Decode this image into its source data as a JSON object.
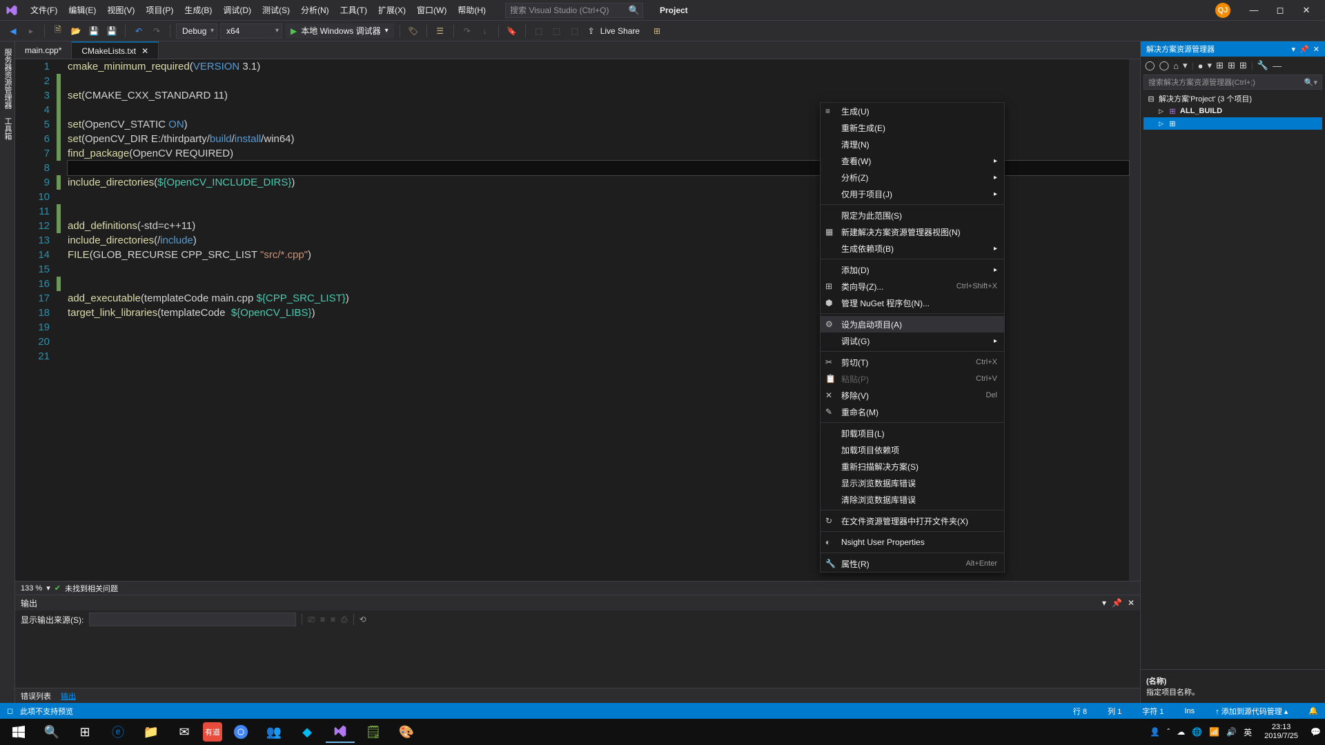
{
  "titlebar": {
    "menus": [
      "文件(F)",
      "编辑(E)",
      "视图(V)",
      "项目(P)",
      "生成(B)",
      "调试(D)",
      "测试(S)",
      "分析(N)",
      "工具(T)",
      "扩展(X)",
      "窗口(W)",
      "帮助(H)"
    ],
    "search_placeholder": "搜索 Visual Studio (Ctrl+Q)",
    "project": "Project",
    "avatar": "QJ"
  },
  "toolbar": {
    "config": "Debug",
    "platform": "x64",
    "run": "本地 Windows 调试器",
    "live_share": "Live Share"
  },
  "tabs": [
    {
      "label": "main.cpp*",
      "active": false
    },
    {
      "label": "CMakeLists.txt",
      "active": true
    }
  ],
  "editor": {
    "lines": [
      {
        "n": 1,
        "mod": false,
        "tokens": [
          [
            "fn",
            "cmake_minimum_required"
          ],
          [
            "txt",
            "("
          ],
          [
            "kw",
            "VERSION"
          ],
          [
            "txt",
            " 3.1)"
          ]
        ]
      },
      {
        "n": 2,
        "mod": true,
        "tokens": []
      },
      {
        "n": 3,
        "mod": true,
        "tokens": [
          [
            "fn",
            "set"
          ],
          [
            "txt",
            "(CMAKE_CXX_STANDARD 11)"
          ]
        ]
      },
      {
        "n": 4,
        "mod": true,
        "tokens": []
      },
      {
        "n": 5,
        "mod": true,
        "tokens": [
          [
            "fn",
            "set"
          ],
          [
            "txt",
            "(OpenCV_STATIC "
          ],
          [
            "kw",
            "ON"
          ],
          [
            "txt",
            ")"
          ]
        ]
      },
      {
        "n": 6,
        "mod": true,
        "tokens": [
          [
            "fn",
            "set"
          ],
          [
            "txt",
            "(OpenCV_DIR E:/thirdparty/"
          ],
          [
            "path",
            "build"
          ],
          [
            "txt",
            "/"
          ],
          [
            "path",
            "install"
          ],
          [
            "txt",
            "/win64)"
          ]
        ]
      },
      {
        "n": 7,
        "mod": true,
        "tokens": [
          [
            "fn",
            "find_package"
          ],
          [
            "txt",
            "(OpenCV REQUIRED)"
          ]
        ]
      },
      {
        "n": 8,
        "mod": false,
        "current": true,
        "tokens": []
      },
      {
        "n": 9,
        "mod": true,
        "tokens": [
          [
            "fn",
            "include_directories"
          ],
          [
            "txt",
            "("
          ],
          [
            "var",
            "${OpenCV_INCLUDE_DIRS}"
          ],
          [
            "txt",
            ")"
          ]
        ]
      },
      {
        "n": 10,
        "mod": false,
        "tokens": []
      },
      {
        "n": 11,
        "mod": true,
        "tokens": []
      },
      {
        "n": 12,
        "mod": true,
        "tokens": [
          [
            "fn",
            "add_definitions"
          ],
          [
            "txt",
            "(-std=c++11)"
          ]
        ]
      },
      {
        "n": 13,
        "mod": false,
        "tokens": [
          [
            "fn",
            "include_directories"
          ],
          [
            "txt",
            "(/"
          ],
          [
            "path",
            "include"
          ],
          [
            "txt",
            ")"
          ]
        ]
      },
      {
        "n": 14,
        "mod": false,
        "tokens": [
          [
            "fn",
            "FILE"
          ],
          [
            "txt",
            "(GLOB_RECURSE CPP_SRC_LIST "
          ],
          [
            "str",
            "\"src/*.cpp\""
          ],
          [
            "txt",
            ")"
          ]
        ]
      },
      {
        "n": 15,
        "mod": false,
        "tokens": []
      },
      {
        "n": 16,
        "mod": true,
        "tokens": []
      },
      {
        "n": 17,
        "mod": false,
        "tokens": [
          [
            "fn",
            "add_executable"
          ],
          [
            "txt",
            "(templateCode main.cpp "
          ],
          [
            "var",
            "${CPP_SRC_LIST}"
          ],
          [
            "txt",
            ")"
          ]
        ]
      },
      {
        "n": 18,
        "mod": false,
        "tokens": [
          [
            "fn",
            "target_link_libraries"
          ],
          [
            "txt",
            "(templateCode  "
          ],
          [
            "var",
            "${OpenCV_LIBS}"
          ],
          [
            "txt",
            ")"
          ]
        ]
      },
      {
        "n": 19,
        "mod": false,
        "tokens": []
      },
      {
        "n": 20,
        "mod": false,
        "tokens": []
      },
      {
        "n": 21,
        "mod": false,
        "tokens": []
      }
    ],
    "zoom": "133 %",
    "problems": "未找到相关问题"
  },
  "output": {
    "title": "输出",
    "source_label": "显示输出来源(S):"
  },
  "bottom_tabs": [
    "错误列表",
    "输出"
  ],
  "solution": {
    "title": "解决方案资源管理器",
    "search_placeholder": "搜索解决方案资源管理器(Ctrl+;)",
    "root": "解决方案'Project' (3 个项目)",
    "items": [
      "ALL_BUILD"
    ],
    "prop_name_label": "(名称)",
    "prop_name_desc": "指定项目名称。"
  },
  "context_menu": {
    "items": [
      {
        "label": "生成(U)",
        "icon": "≡"
      },
      {
        "label": "重新生成(E)"
      },
      {
        "label": "清理(N)"
      },
      {
        "label": "查看(W)",
        "sub": true
      },
      {
        "label": "分析(Z)",
        "sub": true
      },
      {
        "label": "仅用于项目(J)",
        "sub": true
      },
      {
        "sep": true
      },
      {
        "label": "限定为此范围(S)"
      },
      {
        "label": "新建解决方案资源管理器视图(N)",
        "icon": "▦"
      },
      {
        "label": "生成依赖项(B)",
        "sub": true
      },
      {
        "sep": true
      },
      {
        "label": "添加(D)",
        "sub": true
      },
      {
        "label": "类向导(Z)...",
        "shortcut": "Ctrl+Shift+X",
        "icon": "⊞"
      },
      {
        "label": "管理 NuGet 程序包(N)...",
        "icon": "⬢"
      },
      {
        "sep": true
      },
      {
        "label": "设为启动项目(A)",
        "icon": "⚙",
        "selected": true
      },
      {
        "label": "调试(G)",
        "sub": true
      },
      {
        "sep": true
      },
      {
        "label": "剪切(T)",
        "shortcut": "Ctrl+X",
        "icon": "✂"
      },
      {
        "label": "粘贴(P)",
        "shortcut": "Ctrl+V",
        "disabled": true,
        "icon": "📋"
      },
      {
        "label": "移除(V)",
        "shortcut": "Del",
        "icon": "✕"
      },
      {
        "label": "重命名(M)",
        "icon": "✎"
      },
      {
        "sep": true
      },
      {
        "label": "卸载项目(L)"
      },
      {
        "label": "加载项目依赖项"
      },
      {
        "label": "重新扫描解决方案(S)"
      },
      {
        "label": "显示浏览数据库错误"
      },
      {
        "label": "清除浏览数据库错误"
      },
      {
        "sep": true
      },
      {
        "label": "在文件资源管理器中打开文件夹(X)",
        "icon": "↻"
      },
      {
        "sep": true
      },
      {
        "label": "Nsight User Properties",
        "icon": "◐"
      },
      {
        "sep": true
      },
      {
        "label": "属性(R)",
        "shortcut": "Alt+Enter",
        "icon": "🔧"
      }
    ]
  },
  "statusbar": {
    "msg": "此项不支持预览",
    "line": "行 8",
    "col": "列 1",
    "char": "字符 1",
    "ins": "Ins",
    "scm": "↑ 添加到源代码管理 ▴"
  },
  "taskbar": {
    "time": "23:13",
    "date": "2019/7/25",
    "ime": "英"
  }
}
